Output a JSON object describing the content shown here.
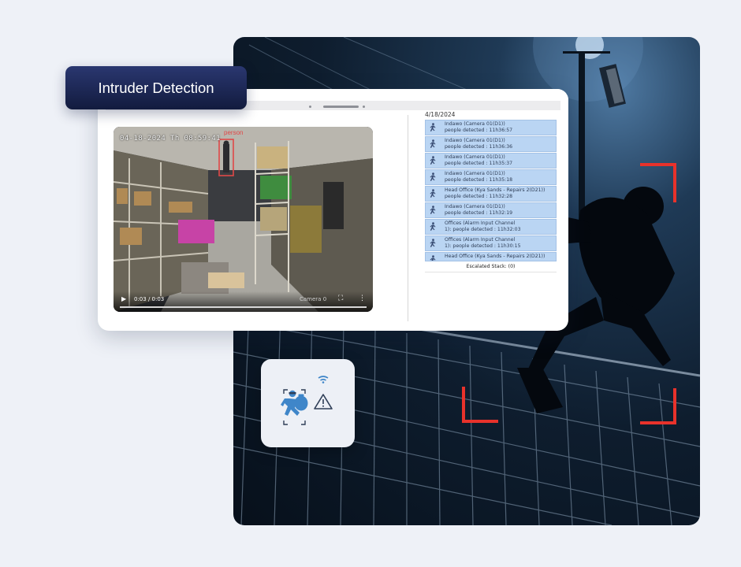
{
  "title": "Intruder Detection",
  "video": {
    "timestamp_overlay": "04-18-2024 Th 08:59:41",
    "detection_tag": "person",
    "time_display": "0:03 / 0:03",
    "caption_fragment": "Camera 0",
    "playback_progress": 1.0
  },
  "alerts": {
    "date": "4/18/2024",
    "items": [
      {
        "line1": "Indawo (Camera 01(D1))",
        "line2": "people detected : 11h36:57"
      },
      {
        "line1": "Indawo (Camera 01(D1))",
        "line2": "people detected : 11h36:36"
      },
      {
        "line1": "Indawo (Camera 01(D1))",
        "line2": "people detected : 11h35:37"
      },
      {
        "line1": "Indawo (Camera 01(D1))",
        "line2": "people detected : 11h35:18"
      },
      {
        "line1": "Head Office (Kya Sands - Repairs 2(D21))",
        "line2": "people detected : 11h32:28"
      },
      {
        "line1": "Indawo (Camera 01(D1))",
        "line2": "people detected : 11h32:19"
      },
      {
        "line1": "Offices (Alarm Input Channel",
        "line2": "1): people detected : 11h32:03"
      },
      {
        "line1": "Offices (Alarm Input Channel",
        "line2": "1): people detected : 11h30:15"
      },
      {
        "line1": "Head Office (Kya Sands - Repairs 2(D21))",
        "line2": ""
      }
    ],
    "escalated_label": "Escalated Stack: (0)"
  },
  "colors": {
    "title_bg": "#1b2550",
    "alert_bg": "#bad5f3",
    "alert_icon": "#3b4f76",
    "corner_bracket": "#e8322b",
    "icon_blue": "#3f86c9"
  },
  "icons": {
    "alert_row": "running-person-icon",
    "card": "intruder-alert-icon"
  }
}
